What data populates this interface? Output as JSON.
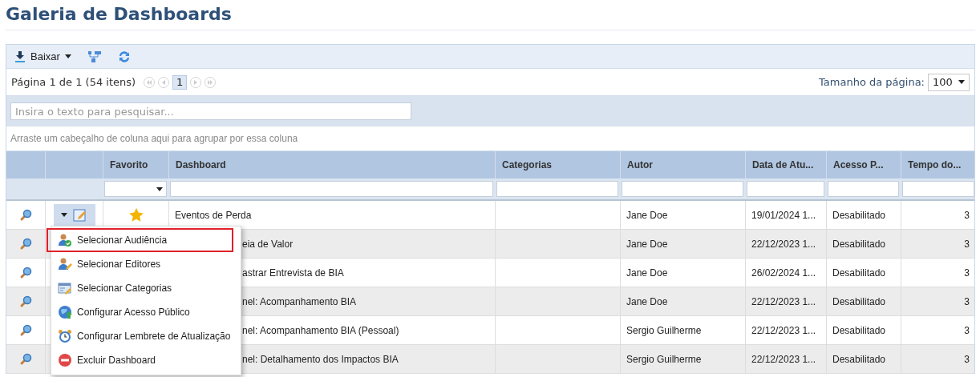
{
  "title": "Galeria de Dashboards",
  "toolbar": {
    "download_label": "Baixar"
  },
  "pager": {
    "summary": "Página 1 de 1 (54 itens)",
    "pages": [
      {
        "label": "1",
        "selected": true
      }
    ],
    "page_size_label": "Tamanho da página:",
    "page_size": "100"
  },
  "search": {
    "placeholder": "Insira o texto para pesquisar..."
  },
  "group_hint": "Arraste um cabeçalho de coluna aqui para agrupar por essa coluna",
  "columns": [
    "Favorito",
    "Dashboard",
    "Categorias",
    "Autor",
    "Data de Atu...",
    "Acesso P...",
    "Tempo do..."
  ],
  "rows": [
    {
      "favorite": true,
      "dashboard": "Eventos de Perda",
      "author": "Jane Doe",
      "date": "19/01/2024 1...",
      "access": "Desabilitado",
      "time": "3"
    },
    {
      "dashboard": "eia de Valor",
      "author": "Jane Doe",
      "date": "22/12/2023 1...",
      "access": "Desabilitado",
      "time": "3"
    },
    {
      "dashboard": "astrar Entrevista de BIA",
      "author": "Jane Doe",
      "date": "26/02/2024 1...",
      "access": "Desabilitado",
      "time": "3"
    },
    {
      "dashboard": "nel: Acompanhamento BIA",
      "author": "Jane Doe",
      "date": "22/12/2023 1...",
      "access": "Desabilitado",
      "time": "3"
    },
    {
      "dashboard": "nel: Acompanhamento BIA (Pessoal)",
      "author": "Sergio Guilherme",
      "date": "22/12/2023 1...",
      "access": "Desabilitado",
      "time": "3"
    },
    {
      "dashboard": "nel: Detalhamento dos Impactos BIA",
      "author": "Sergio Guilherme",
      "date": "22/12/2023 1...",
      "access": "Desabilitado",
      "time": "3"
    }
  ],
  "menu": {
    "items": [
      {
        "label": "Selecionar Audiência",
        "selected": true
      },
      {
        "label": "Selecionar Editores",
        "selected": false
      },
      {
        "label": "Selecionar Categorias",
        "selected": false
      },
      {
        "label": "Configurar Acesso Público",
        "selected": false
      },
      {
        "label": "Configurar Lembrete de Atualização",
        "selected": false
      },
      {
        "label": "Excluir Dashboard",
        "selected": false
      }
    ]
  }
}
